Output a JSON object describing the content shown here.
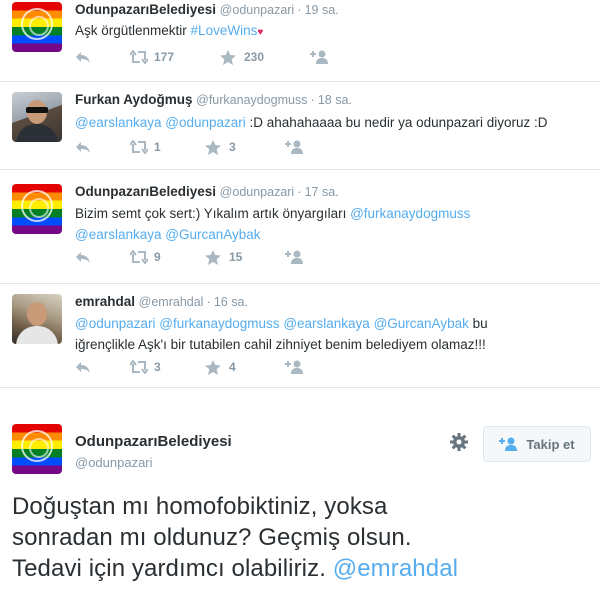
{
  "tweets": [
    {
      "name": "OdunpazarıBelediyesi",
      "handle": "@odunpazari",
      "time": "19 sa.",
      "text": "Aşk örgütlenmektir ",
      "hashtag": "#LoveWins",
      "avatar_icon": "rainbow-seal-avatar",
      "retweets": "177",
      "favorites": "230"
    },
    {
      "name": "Furkan Aydoğmuş",
      "handle": "@furkanaydogmuss",
      "time": "18 sa.",
      "mention1": "@earslankaya",
      "mention2": "@odunpazari",
      "text": " :D ahahahaaaa bu nedir ya odunpazari diyoruz :D",
      "avatar_icon": "user-photo-avatar",
      "retweets": "1",
      "favorites": "3"
    },
    {
      "name": "OdunpazarıBelediyesi",
      "handle": "@odunpazari",
      "time": "17 sa.",
      "text": "Bizim semt çok sert:) Yıkalım artık önyargıları ",
      "mention1": "@furkanaydogmuss",
      "mention2": "@earslankaya",
      "mention3": "@GurcanAybak",
      "avatar_icon": "rainbow-seal-avatar",
      "retweets": "9",
      "favorites": "15"
    },
    {
      "name": "emrahdal",
      "handle": "@emrahdal",
      "time": "16 sa.",
      "mention1": "@odunpazari",
      "mention2": "@furkanaydogmuss",
      "mention3": "@earslankaya",
      "mention4": "@GurcanAybak",
      "text_a": " bu",
      "text_b": "iğrençlikle Aşk'ı bir tutabilen cahil zihniyet benim belediyem olamaz!!!",
      "avatar_icon": "user-photo-avatar",
      "retweets": "3",
      "favorites": "4"
    }
  ],
  "main_tweet": {
    "name": "OdunpazarıBelediyesi",
    "handle": "@odunpazari",
    "follow_label": "Takip et",
    "line1": "Doğuştan mı homofobiktiniz, yoksa",
    "line2": "sonradan mı oldunuz? Geçmiş olsun.",
    "line3": "Tedavi için yardımcı olabiliriz. ",
    "mention": "@emrahdal"
  },
  "colors": {
    "link": "#55acee",
    "text": "#292f33",
    "muted": "#8899a6",
    "icon": "#aab8c2"
  }
}
